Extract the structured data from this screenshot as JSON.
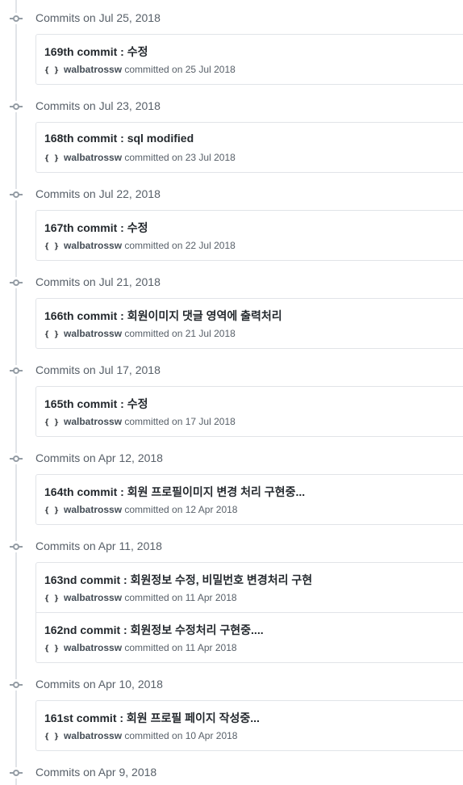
{
  "verb": "committed on",
  "avatar_glyph": "{ }",
  "groups": [
    {
      "title": "Commits on Jul 25, 2018",
      "commits": [
        {
          "title": "169th commit : 수정",
          "author": "walbatrossw",
          "date": "25 Jul 2018"
        }
      ]
    },
    {
      "title": "Commits on Jul 23, 2018",
      "commits": [
        {
          "title": "168th commit : sql modified",
          "author": "walbatrossw",
          "date": "23 Jul 2018"
        }
      ]
    },
    {
      "title": "Commits on Jul 22, 2018",
      "commits": [
        {
          "title": "167th commit : 수정",
          "author": "walbatrossw",
          "date": "22 Jul 2018"
        }
      ]
    },
    {
      "title": "Commits on Jul 21, 2018",
      "commits": [
        {
          "title": "166th commit : 회원이미지 댓글 영역에 출력처리",
          "author": "walbatrossw",
          "date": "21 Jul 2018"
        }
      ]
    },
    {
      "title": "Commits on Jul 17, 2018",
      "commits": [
        {
          "title": "165th commit : 수정",
          "author": "walbatrossw",
          "date": "17 Jul 2018"
        }
      ]
    },
    {
      "title": "Commits on Apr 12, 2018",
      "commits": [
        {
          "title": "164th commit : 회원 프로필이미지 변경 처리 구현중...",
          "author": "walbatrossw",
          "date": "12 Apr 2018"
        }
      ]
    },
    {
      "title": "Commits on Apr 11, 2018",
      "commits": [
        {
          "title": "163nd commit : 회원정보 수정, 비밀번호 변경처리 구현",
          "author": "walbatrossw",
          "date": "11 Apr 2018"
        },
        {
          "title": "162nd commit : 회원정보 수정처리 구현중....",
          "author": "walbatrossw",
          "date": "11 Apr 2018"
        }
      ]
    },
    {
      "title": "Commits on Apr 10, 2018",
      "commits": [
        {
          "title": "161st commit : 회원 프로필 페이지 작성중...",
          "author": "walbatrossw",
          "date": "10 Apr 2018"
        }
      ]
    },
    {
      "title": "Commits on Apr 9, 2018",
      "commits": []
    }
  ]
}
